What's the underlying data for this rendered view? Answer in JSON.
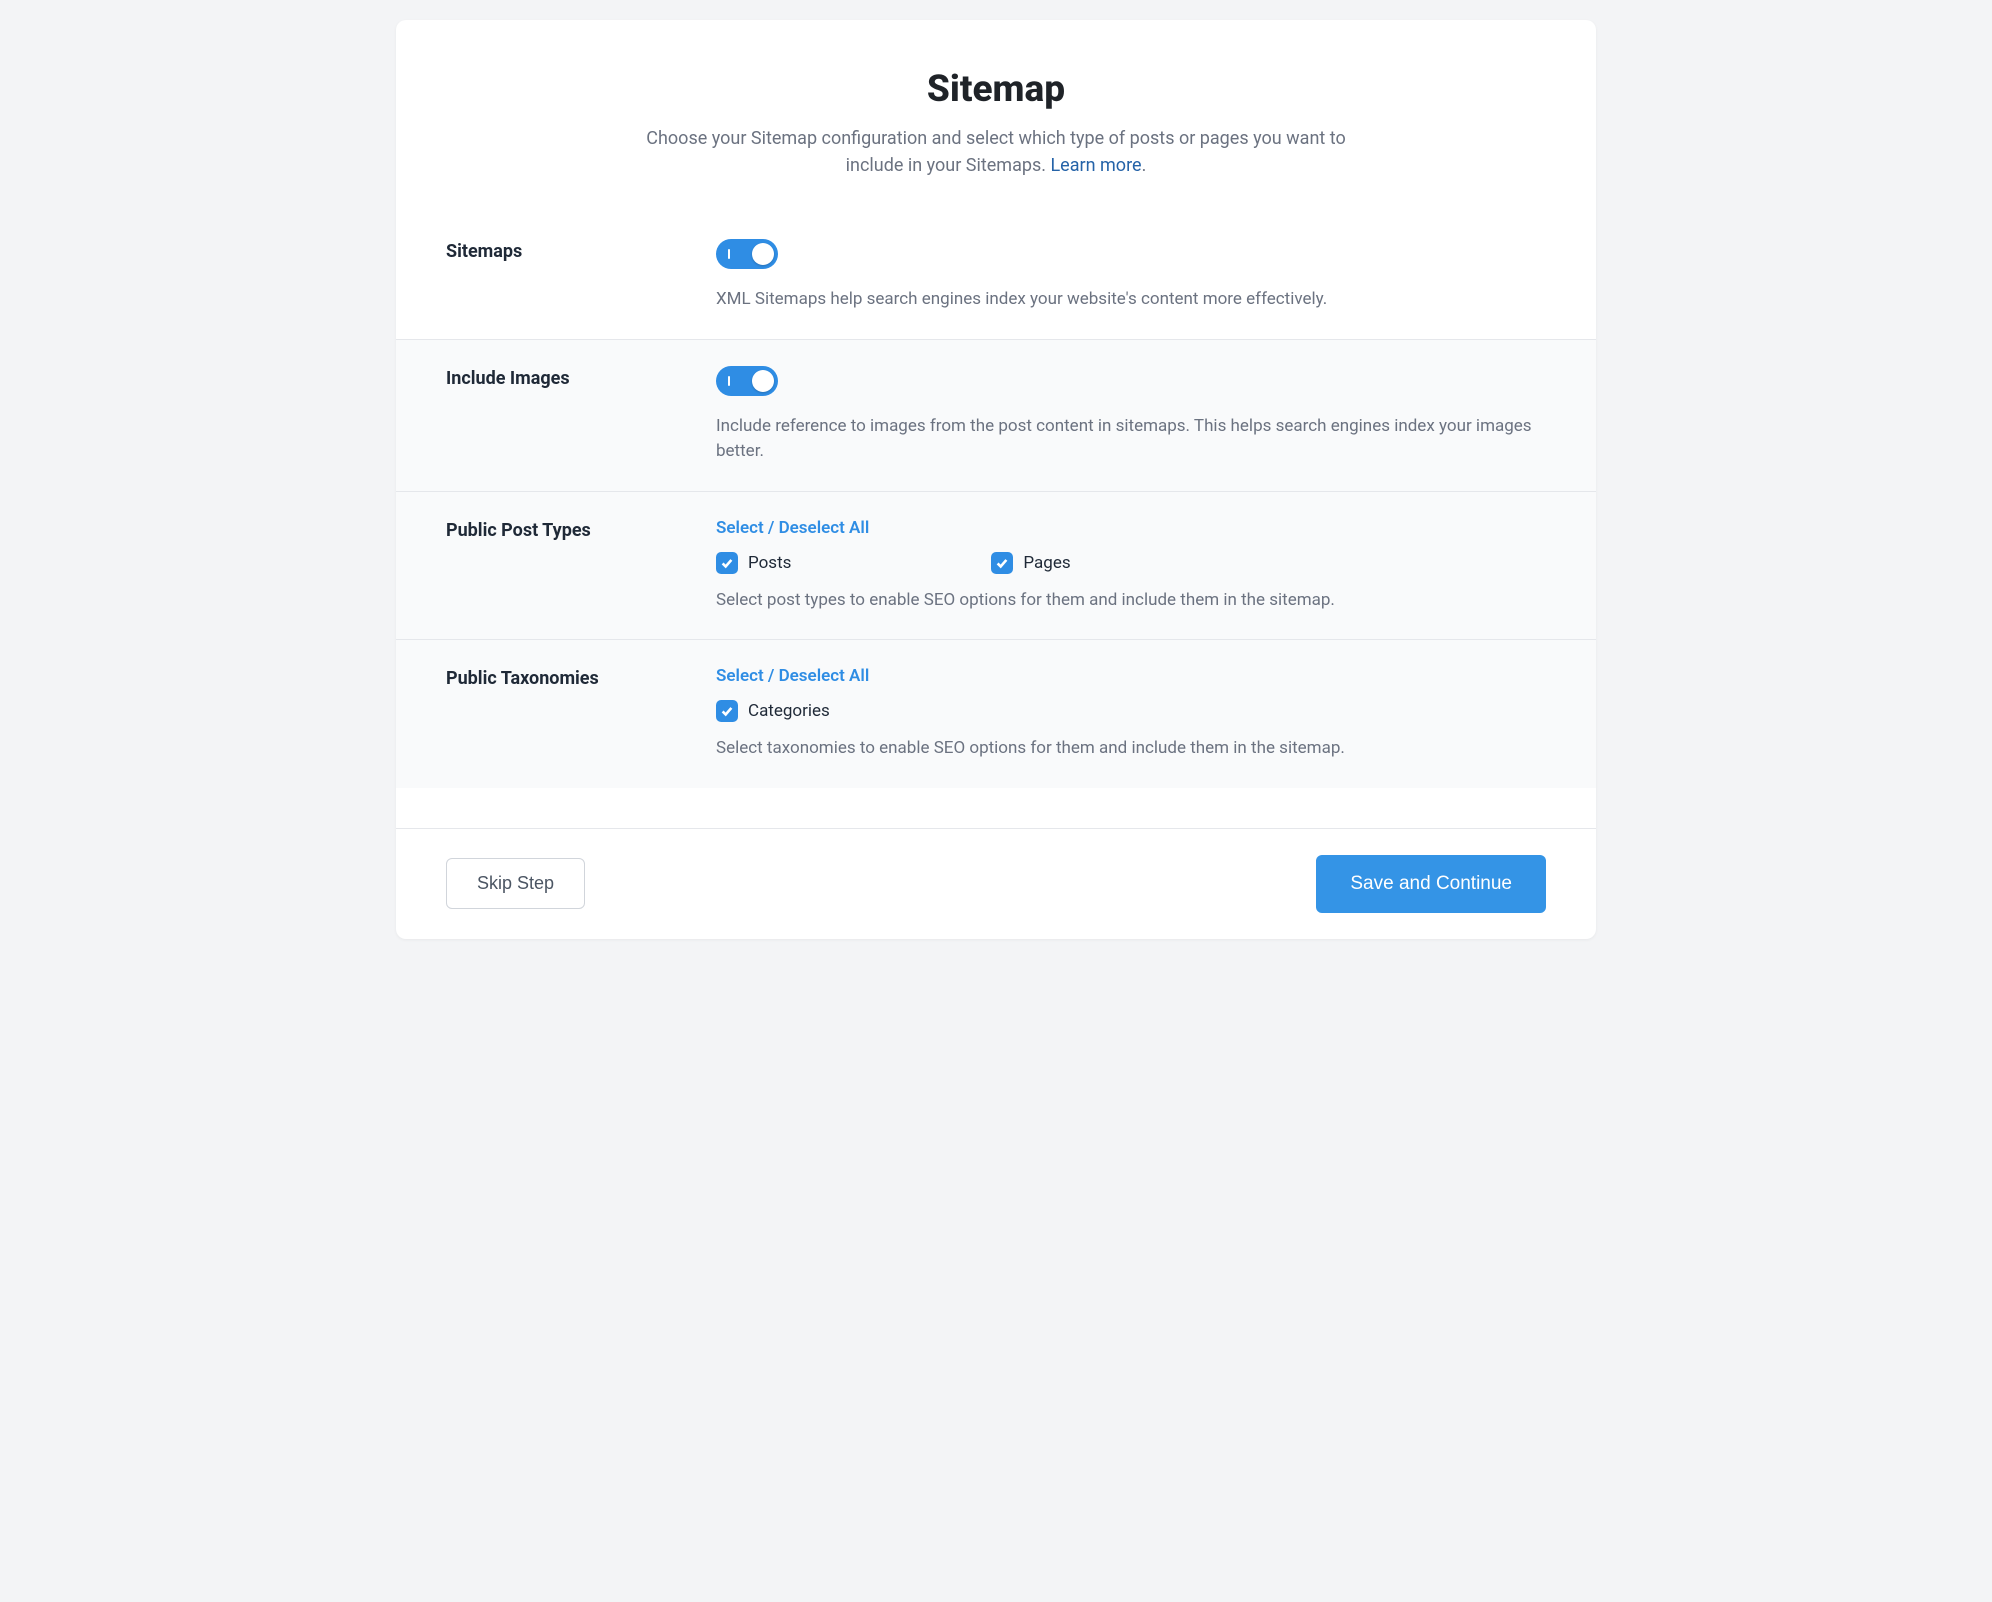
{
  "header": {
    "title": "Sitemap",
    "subtitle_a": "Choose your Sitemap configuration and select which type of posts or pages you want to include in your Sitemaps. ",
    "learn_more": "Learn more",
    "subtitle_b": "."
  },
  "settings": {
    "sitemaps": {
      "label": "Sitemaps",
      "on": true,
      "desc": "XML Sitemaps help search engines index your website's content more effectively."
    },
    "include_images": {
      "label": "Include Images",
      "on": true,
      "desc": "Include reference to images from the post content in sitemaps. This helps search engines index your images better."
    },
    "post_types": {
      "label": "Public Post Types",
      "select_all": "Select / Deselect All",
      "options": [
        {
          "label": "Posts",
          "checked": true
        },
        {
          "label": "Pages",
          "checked": true
        }
      ],
      "desc": "Select post types to enable SEO options for them and include them in the sitemap."
    },
    "taxonomies": {
      "label": "Public Taxonomies",
      "select_all": "Select / Deselect All",
      "options": [
        {
          "label": "Categories",
          "checked": true
        }
      ],
      "desc": "Select taxonomies to enable SEO options for them and include them in the sitemap."
    }
  },
  "footer": {
    "skip": "Skip Step",
    "save": "Save and Continue"
  }
}
